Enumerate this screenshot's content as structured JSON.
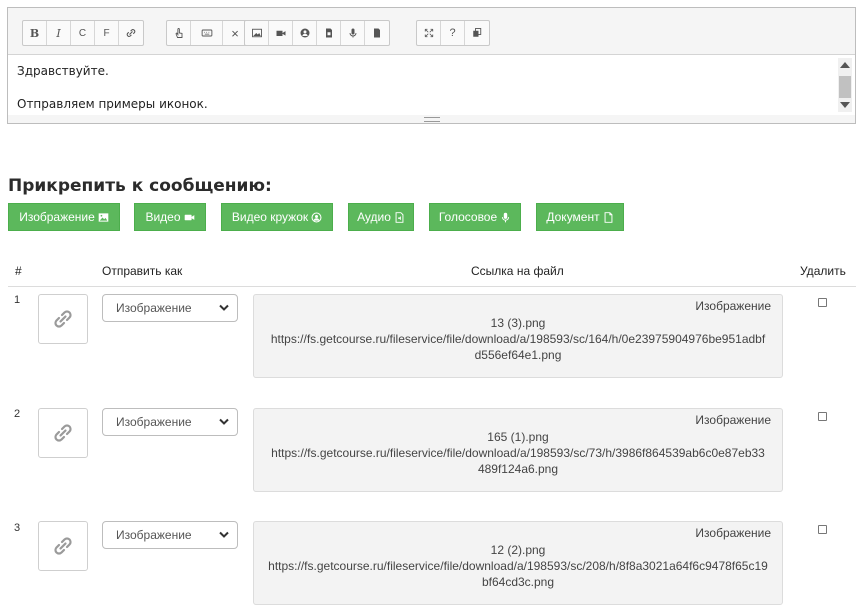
{
  "editor": {
    "toolbar": {
      "bold": "B",
      "italic": "I",
      "c": "C",
      "f": "F",
      "clear": "×",
      "help": "?"
    },
    "lines": [
      "Здравствуйте.",
      "Отправляем примеры иконок."
    ]
  },
  "attach": {
    "title": "Прикрепить к сообщению:",
    "buttons": [
      {
        "label": "Изображение",
        "icon": "image-icon"
      },
      {
        "label": "Видео",
        "icon": "video-camera-icon"
      },
      {
        "label": "Видео кружок",
        "icon": "user-circle-icon"
      },
      {
        "label": "Аудио",
        "icon": "audio-file-icon"
      },
      {
        "label": "Голосовое",
        "icon": "microphone-icon"
      },
      {
        "label": "Документ",
        "icon": "document-icon"
      }
    ],
    "color": "#5cb85c"
  },
  "table": {
    "headers": {
      "num": "#",
      "send_as": "Отправить как",
      "link": "Ссылка на файл",
      "delete": "Удалить"
    },
    "rows": [
      {
        "num": "1",
        "send_as": "Изображение",
        "type": "Изображение",
        "filename": "13 (3).png",
        "url": "https://fs.getcourse.ru/fileservice/file/download/a/198593/sc/164/h/0e23975904976be951adbfd556ef64e1.png"
      },
      {
        "num": "2",
        "send_as": "Изображение",
        "type": "Изображение",
        "filename": "165 (1).png",
        "url": "https://fs.getcourse.ru/fileservice/file/download/a/198593/sc/73/h/3986f864539ab6c0e87eb33489f124a6.png"
      },
      {
        "num": "3",
        "send_as": "Изображение",
        "type": "Изображение",
        "filename": "12 (2).png",
        "url": "https://fs.getcourse.ru/fileservice/file/download/a/198593/sc/208/h/8f8a3021a64f6c9478f65c19bf64cd3c.png"
      }
    ]
  }
}
